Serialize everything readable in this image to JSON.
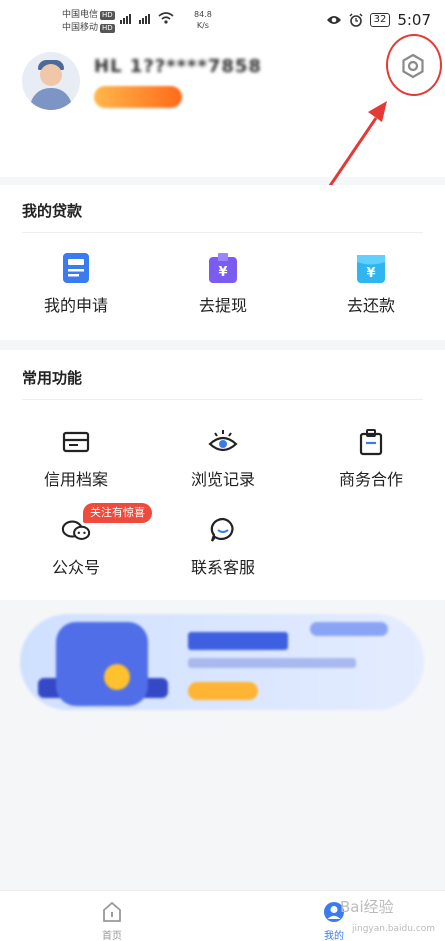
{
  "status_bar": {
    "carrier1": "中国电信",
    "carrier2": "中国移动",
    "hd": "HD",
    "net_speed_value": "84.8",
    "net_speed_unit": "K/s",
    "battery": "32",
    "time": "5:07"
  },
  "profile": {
    "username": "HL 1??****7858",
    "settings_icon": "settings-hexagon-icon"
  },
  "loan_section": {
    "title": "我的贷款",
    "items": [
      {
        "label": "我的申请",
        "icon": "application-doc-icon"
      },
      {
        "label": "去提现",
        "icon": "withdraw-yuan-icon"
      },
      {
        "label": "去还款",
        "icon": "repay-yuan-icon"
      }
    ]
  },
  "common_section": {
    "title": "常用功能",
    "items": [
      {
        "label": "信用档案",
        "icon": "credit-file-icon"
      },
      {
        "label": "浏览记录",
        "icon": "eye-icon"
      },
      {
        "label": "商务合作",
        "icon": "briefcase-icon"
      },
      {
        "label": "公众号",
        "icon": "chat-bubbles-icon"
      },
      {
        "label": "联系客服",
        "icon": "customer-service-icon"
      }
    ],
    "follow_tag": "关注有惊喜"
  },
  "tabbar": {
    "tabs": [
      {
        "label": "首页",
        "icon": "home-icon"
      },
      {
        "label": "我的",
        "icon": "profile-icon"
      }
    ]
  },
  "watermark": {
    "text": "Bai经验",
    "sub": "jingyan.baidu.com"
  },
  "colors": {
    "accent": "#3a7cf0",
    "annotation_red": "#e53935",
    "tag_red": "#ef4a3c"
  }
}
